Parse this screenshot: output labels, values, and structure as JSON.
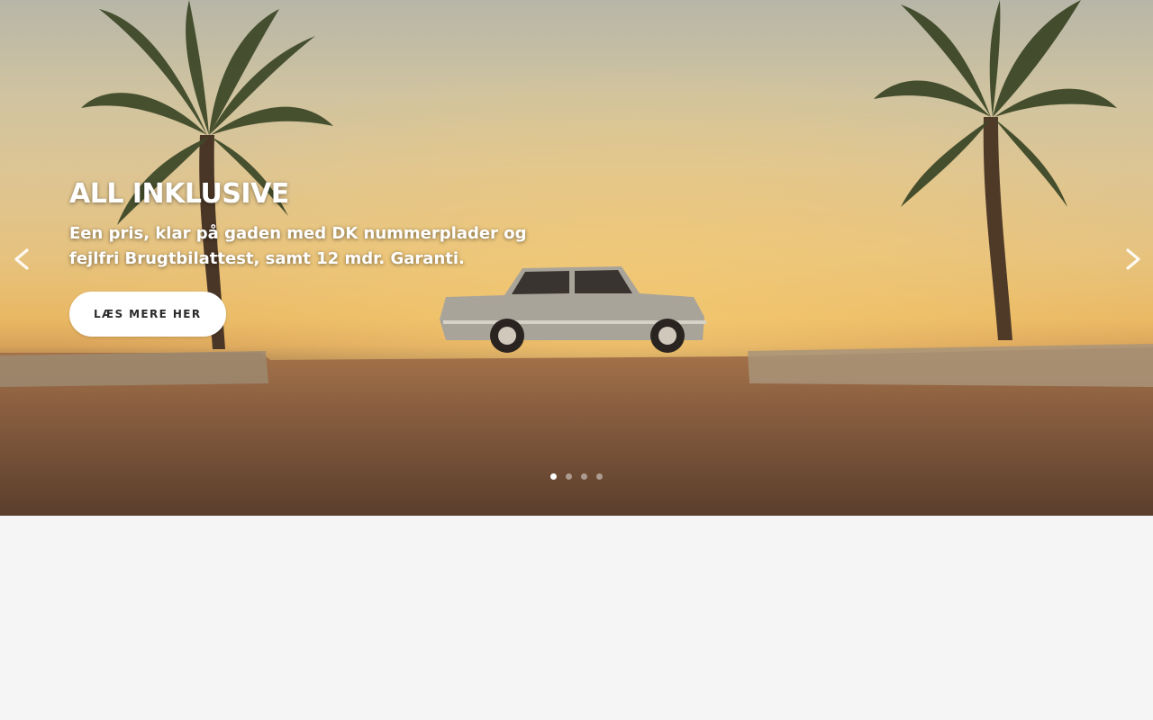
{
  "slider": {
    "slides": [
      {
        "title": "ALL INKLUSIVE",
        "text": "Een pris, klar på gaden med DK nummerplader og fejlfri Brugtbilattest, samt 12 mdr. Garanti.",
        "button_label": "LÆS MERE HER"
      }
    ],
    "active_index": 0,
    "dot_count": 4,
    "prev_icon": "chevron-left-icon",
    "next_icon": "chevron-right-icon"
  },
  "colors": {
    "title_text": "#ffffff",
    "button_bg": "#ffffff",
    "button_text": "#2a2a2a",
    "page_bg": "#f5f5f5"
  }
}
